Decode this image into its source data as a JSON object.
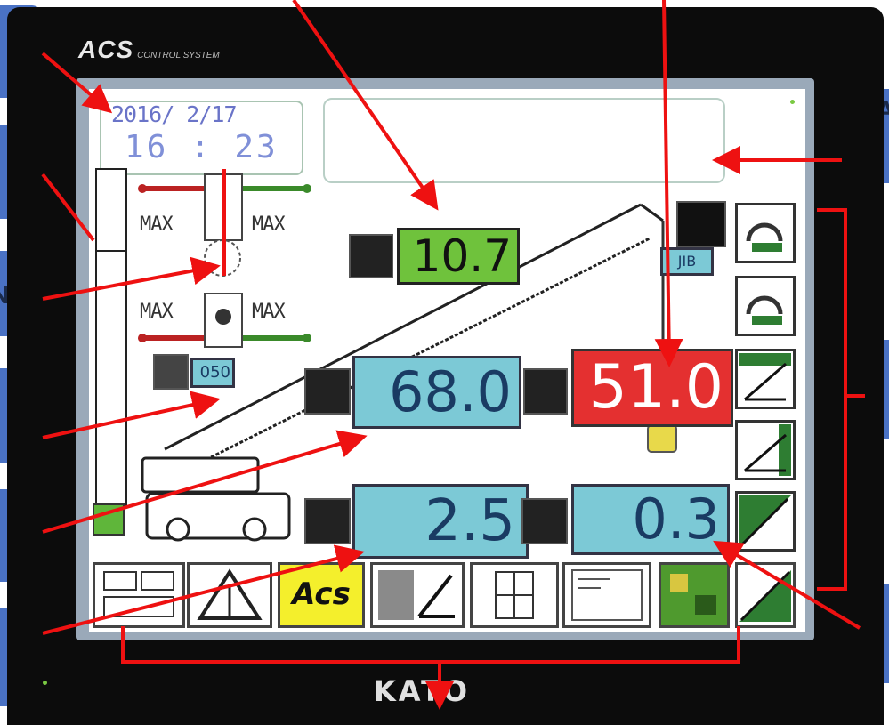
{
  "brand": {
    "top_logo": "ACS",
    "top_sub": "CONTROL SYSTEM",
    "bottom_logo": "KATO"
  },
  "status": {
    "date": "2016/ 2/17",
    "time": "16 : 23"
  },
  "overrides": {
    "max_labels": [
      "MAX",
      "MAX",
      "MAX",
      "MAX"
    ]
  },
  "readouts": {
    "angle": "10.7",
    "boom_length": "68.0",
    "load": "51.0",
    "radius": "2.5",
    "actual_load": "0.3",
    "swing_value": "050",
    "jib_tag": "JIB"
  },
  "bottom_buttons": [
    "counterweight",
    "warning",
    "Acs",
    "angle-limit",
    "hook",
    "info-sheet",
    "outrigger-map",
    "slope"
  ],
  "side_buttons": [
    "hook-up",
    "hook-down",
    "angle-1",
    "angle-2",
    "angle-3",
    "angle-4"
  ],
  "colors": {
    "green": "#6fc23c",
    "cyan": "#7cc9d6",
    "red": "#e43030",
    "callout": "#4a72c4",
    "arrow": "#e11111"
  }
}
